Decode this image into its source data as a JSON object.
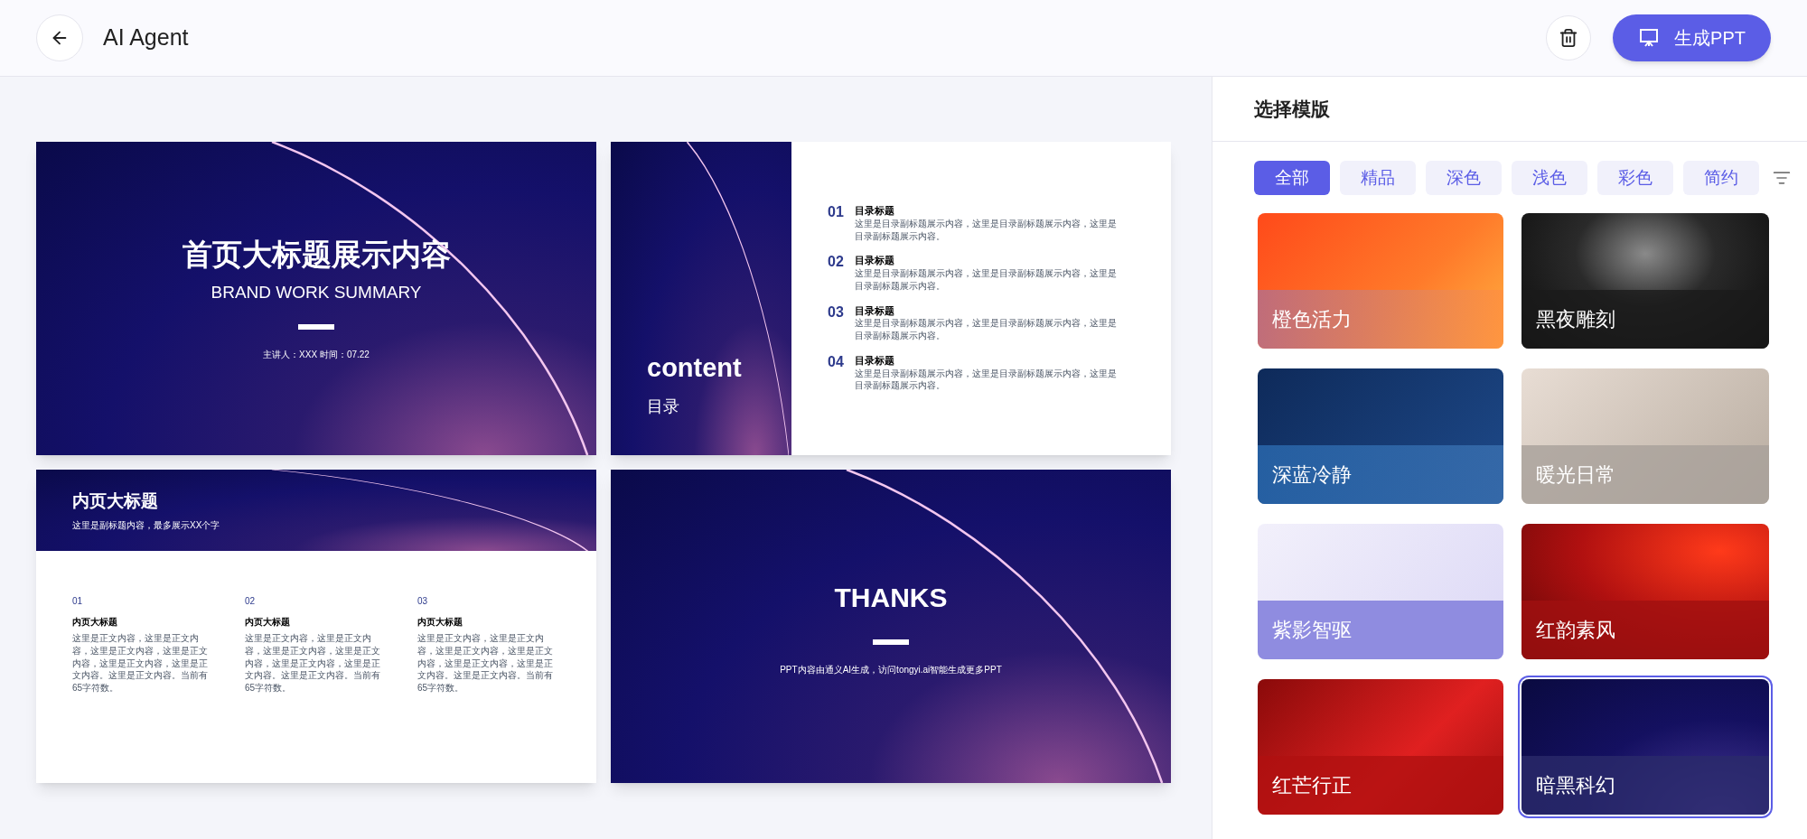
{
  "header": {
    "title": "AI Agent",
    "generate_button": "生成PPT"
  },
  "slides": [
    {
      "kind": "cover",
      "title": "首页大标题展示内容",
      "subtitle": "BRAND WORK SUMMARY",
      "meta": "主讲人：XXX 时间：07.22"
    },
    {
      "kind": "toc",
      "title": "content",
      "subtitle": "目录",
      "items": [
        {
          "number": "01",
          "title": "目录标题",
          "text": "这里是目录副标题展示内容，这里是目录副标题展示内容，这里是目录副标题展示内容。"
        },
        {
          "number": "02",
          "title": "目录标题",
          "text": "这里是目录副标题展示内容，这里是目录副标题展示内容，这里是目录副标题展示内容。"
        },
        {
          "number": "03",
          "title": "目录标题",
          "text": "这里是目录副标题展示内容，这里是目录副标题展示内容，这里是目录副标题展示内容。"
        },
        {
          "number": "04",
          "title": "目录标题",
          "text": "这里是目录副标题展示内容，这里是目录副标题展示内容，这里是目录副标题展示内容。"
        }
      ]
    },
    {
      "kind": "content",
      "title": "内页大标题",
      "subtitle": "这里是副标题内容，最多展示XX个字",
      "items": [
        {
          "number": "01",
          "title": "内页大标题",
          "text": "这里是正文内容，这里是正文内容，这里是正文内容，这里是正文内容，这里是正文内容，这里是正文内容。这里是正文内容。当前有65字符数。"
        },
        {
          "number": "02",
          "title": "内页大标题",
          "text": "这里是正文内容，这里是正文内容，这里是正文内容，这里是正文内容，这里是正文内容，这里是正文内容。这里是正文内容。当前有65字符数。"
        },
        {
          "number": "03",
          "title": "内页大标题",
          "text": "这里是正文内容，这里是正文内容，这里是正文内容，这里是正文内容，这里是正文内容，这里是正文内容。这里是正文内容。当前有65字符数。"
        }
      ]
    },
    {
      "kind": "thanks",
      "title": "THANKS",
      "note": "PPT内容由通义AI生成，访问tongyi.ai智能生成更多PPT"
    }
  ],
  "template_panel": {
    "title": "选择模版",
    "filters": [
      {
        "label": "全部",
        "selected": true
      },
      {
        "label": "精品",
        "selected": false
      },
      {
        "label": "深色",
        "selected": false
      },
      {
        "label": "浅色",
        "selected": false
      },
      {
        "label": "彩色",
        "selected": false
      },
      {
        "label": "简约",
        "selected": false
      }
    ],
    "templates": [
      {
        "name": "橙色活力",
        "selected": false
      },
      {
        "name": "黑夜雕刻",
        "selected": false
      },
      {
        "name": "深蓝冷静",
        "selected": false
      },
      {
        "name": "暖光日常",
        "selected": false
      },
      {
        "name": "紫影智驱",
        "selected": false
      },
      {
        "name": "红韵素风",
        "selected": false
      },
      {
        "name": "红芒行正",
        "selected": false
      },
      {
        "name": "暗黑科幻",
        "selected": true
      }
    ]
  }
}
